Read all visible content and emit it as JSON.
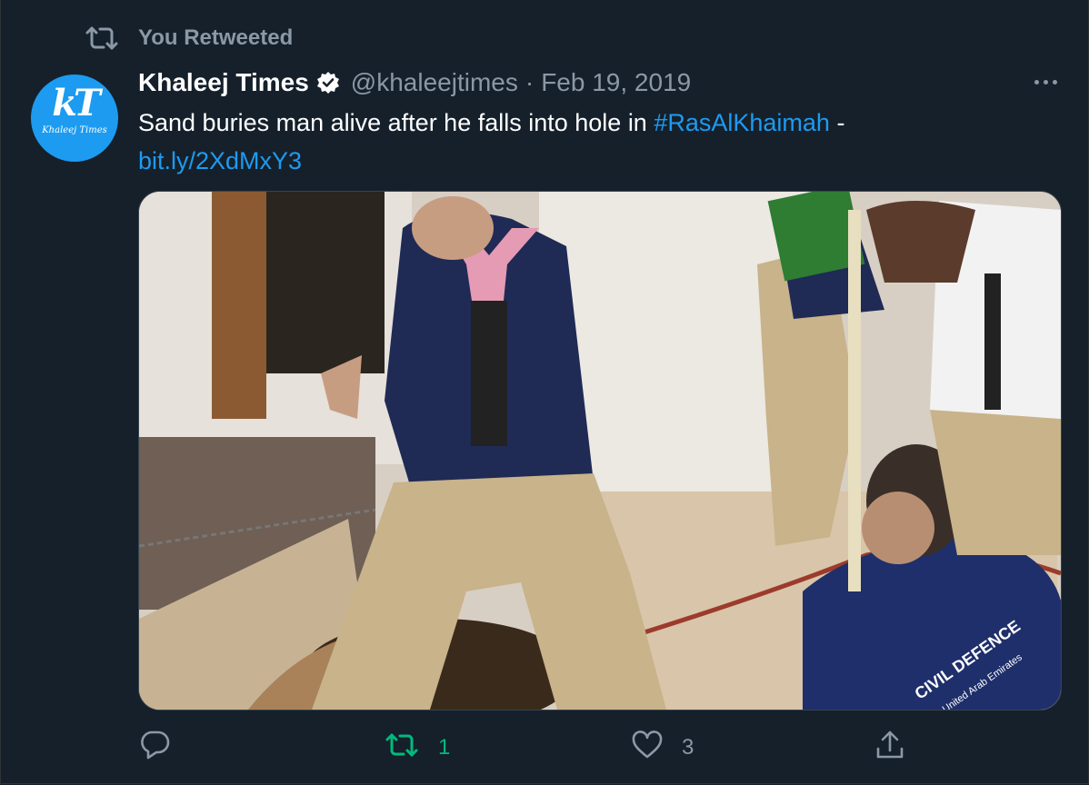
{
  "retweet_banner": {
    "label": "You Retweeted"
  },
  "tweet": {
    "avatar": {
      "initials": "kT",
      "subtitle": "Khaleej Times"
    },
    "author_name": "Khaleej Times",
    "handle": "@khaleejtimes",
    "separator": "·",
    "date": "Feb 19, 2019",
    "text_prefix": "Sand buries man alive after he falls into hole in ",
    "hashtag": "#RasAlKhaimah",
    "text_suffix": " -",
    "link": "bit.ly/2XdMxY3",
    "image": {
      "uniform_text_line1": "CIVIL DEFENCE",
      "uniform_text_line2": "United Arab Emirates"
    }
  },
  "actions": {
    "reply_count": "",
    "retweet_count": "1",
    "like_count": "3"
  },
  "colors": {
    "background": "#15202b",
    "accent": "#1d9bf0",
    "retweet_green": "#00ba7c",
    "muted": "#8b98a5"
  },
  "icons": [
    "retweet-icon",
    "verified-badge-icon",
    "more-icon",
    "reply-icon",
    "like-icon",
    "share-icon"
  ]
}
